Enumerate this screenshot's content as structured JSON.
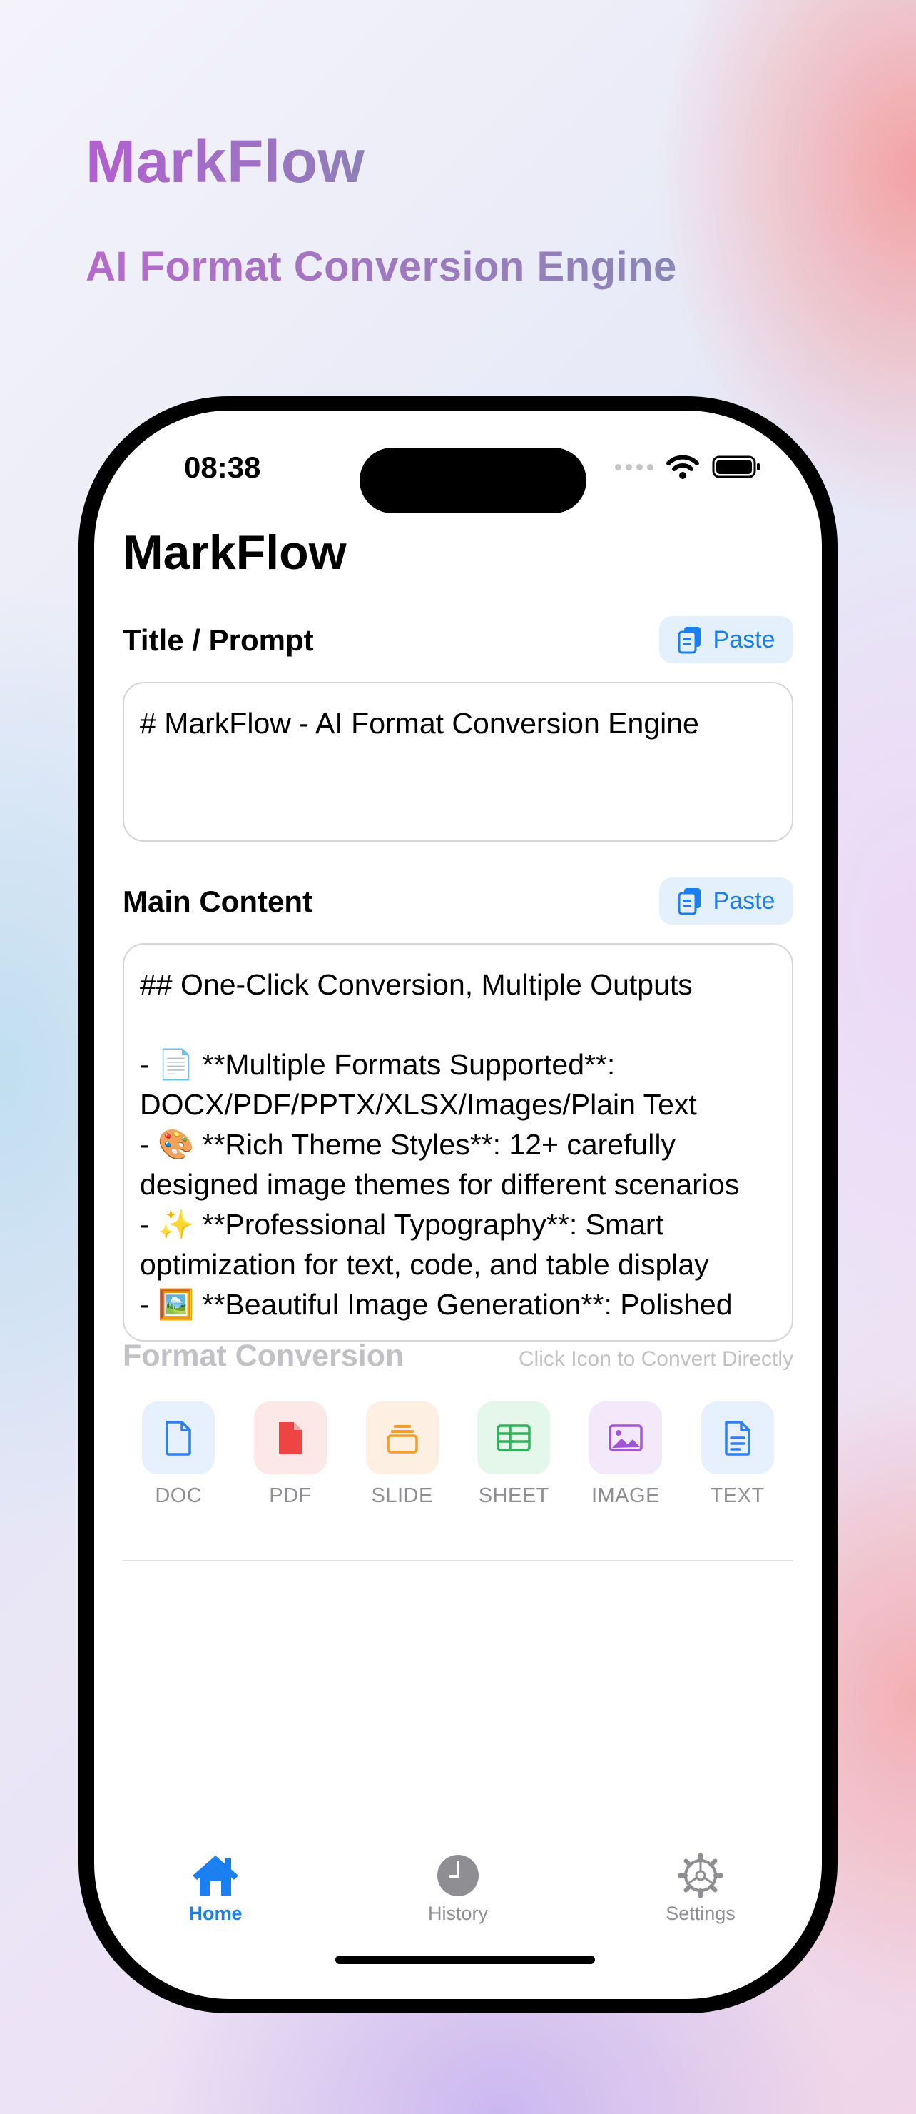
{
  "hero": {
    "title": "MarkFlow",
    "subtitle": "AI Format Conversion Engine"
  },
  "status_bar": {
    "time": "08:38"
  },
  "app": {
    "title": "MarkFlow"
  },
  "title_section": {
    "label": "Title / Prompt",
    "paste_label": "Paste",
    "value": "# MarkFlow - AI Format Conversion Engine"
  },
  "content_section": {
    "label": "Main Content",
    "paste_label": "Paste",
    "value": "## One-Click Conversion, Multiple Outputs\n\n- 📄 **Multiple Formats Supported**: DOCX/PDF/PPTX/XLSX/Images/Plain Text\n- 🎨 **Rich Theme Styles**: 12+ carefully designed image themes for different scenarios\n- ✨ **Professional Typography**: Smart optimization for text, code, and table display\n- 🖼️ **Beautiful Image Generation**: Polished"
  },
  "format_conversion": {
    "title": "Format Conversion",
    "hint": "Click Icon to Convert Directly",
    "formats": [
      {
        "label": "DOC",
        "icon": "doc-icon",
        "tile_color": "#e6f1fd",
        "icon_color": "#2f80ec"
      },
      {
        "label": "PDF",
        "icon": "pdf-icon",
        "tile_color": "#fde8e8",
        "icon_color": "#ef4444"
      },
      {
        "label": "SLIDE",
        "icon": "slide-icon",
        "tile_color": "#fdf0e2",
        "icon_color": "#f59e2b"
      },
      {
        "label": "SHEET",
        "icon": "sheet-icon",
        "tile_color": "#e5f6ea",
        "icon_color": "#2eb35a"
      },
      {
        "label": "IMAGE",
        "icon": "image-icon",
        "tile_color": "#f4e8fb",
        "icon_color": "#a055d8"
      },
      {
        "label": "TEXT",
        "icon": "text-icon",
        "tile_color": "#e6f1fd",
        "icon_color": "#2f80ec"
      }
    ]
  },
  "tabbar": {
    "tabs": [
      {
        "label": "Home",
        "icon": "house-icon",
        "active": true
      },
      {
        "label": "History",
        "icon": "clock-icon",
        "active": false
      },
      {
        "label": "Settings",
        "icon": "gear-icon",
        "active": false
      }
    ]
  },
  "colors": {
    "accent": "#1a7ff0",
    "inactive": "#8e8e93"
  }
}
